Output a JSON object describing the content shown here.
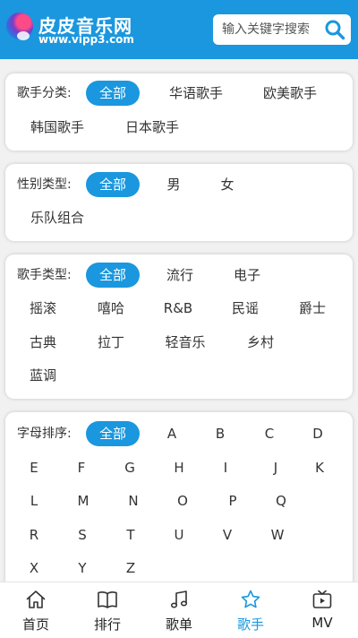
{
  "header": {
    "site_name": "皮皮音乐网",
    "site_url": "www.vipp3.com",
    "search_placeholder": "输入关键字搜索"
  },
  "filters": {
    "region": {
      "label": "歌手分类:",
      "options": [
        "全部",
        "华语歌手",
        "欧美歌手",
        "韩国歌手",
        "日本歌手"
      ],
      "selected": "全部"
    },
    "gender": {
      "label": "性别类型:",
      "options": [
        "全部",
        "男",
        "女",
        "乐队组合"
      ],
      "selected": "全部"
    },
    "genre": {
      "label": "歌手类型:",
      "options": [
        "全部",
        "流行",
        "电子",
        "摇滚",
        "嘻哈",
        "R&B",
        "民谣",
        "爵士",
        "古典",
        "拉丁",
        "轻音乐",
        "乡村",
        "蓝调"
      ],
      "selected": "全部"
    },
    "letter": {
      "label": "字母排序:",
      "options": [
        "全部",
        "A",
        "B",
        "C",
        "D",
        "E",
        "F",
        "G",
        "H",
        "I",
        "J",
        "K",
        "L",
        "M",
        "N",
        "O",
        "P",
        "Q",
        "R",
        "S",
        "T",
        "U",
        "V",
        "W",
        "X",
        "Y",
        "Z"
      ],
      "selected": "全部"
    }
  },
  "tabbar": {
    "items": [
      {
        "label": "首页",
        "icon": "home-icon"
      },
      {
        "label": "排行",
        "icon": "book-icon"
      },
      {
        "label": "歌单",
        "icon": "music-note-icon"
      },
      {
        "label": "歌手",
        "icon": "star-icon"
      },
      {
        "label": "MV",
        "icon": "tv-icon"
      }
    ],
    "active": "歌手"
  },
  "colors": {
    "accent": "#1a97de",
    "background": "#f1f1f1",
    "text": "#333333"
  }
}
